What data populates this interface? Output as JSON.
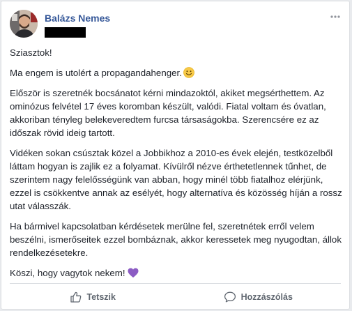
{
  "post": {
    "author": "Balázs Nemes",
    "avatar_icon": "profile-photo"
  },
  "content": {
    "p1": "Sziasztok!",
    "p2": "Ma engem is utolért a propagandahenger.",
    "p2_emoji": "smiley-emoji",
    "p3": "Először is szeretnék bocsánatot kérni mindazoktól, akiket megsérthettem. Az ominózus felvétel 17 éves koromban készült, valódi. Fiatal voltam és óvatlan, akkoriban tényleg belekeveredtem furcsa társaságokba. Szerencsére ez az időszak rövid ideig tartott.",
    "p4": "Vidéken sokan csúsztak közel a Jobbikhoz a 2010-es évek elején, testközelből láttam hogyan is zajlik ez a folyamat. Kívülről nézve érthetetlennek tűnhet, de szerintem nagy felelősségünk van abban, hogy minél több fiatalhoz elérjünk, ezzel is csökkentve annak az esélyét, hogy alternatíva és közösség híján a rossz utat válasszák.",
    "p5": "Ha bármivel kapcsolatban kérdésetek merülne fel, szeretnétek erről velem beszélni, ismerőseitek ezzel bombáznak, akkor keressetek meg nyugodtan, állok rendelkezésetekre.",
    "p6": "Köszi, hogy vagytok nekem!",
    "p6_emoji": "purple-heart-emoji"
  },
  "actions": {
    "like_label": "Tetszik",
    "comment_label": "Hozzászólás"
  },
  "colors": {
    "author": "#365899",
    "text": "#1d2129",
    "action": "#606770",
    "heart": "#8c5cc4",
    "smiley": "#f7c948"
  }
}
